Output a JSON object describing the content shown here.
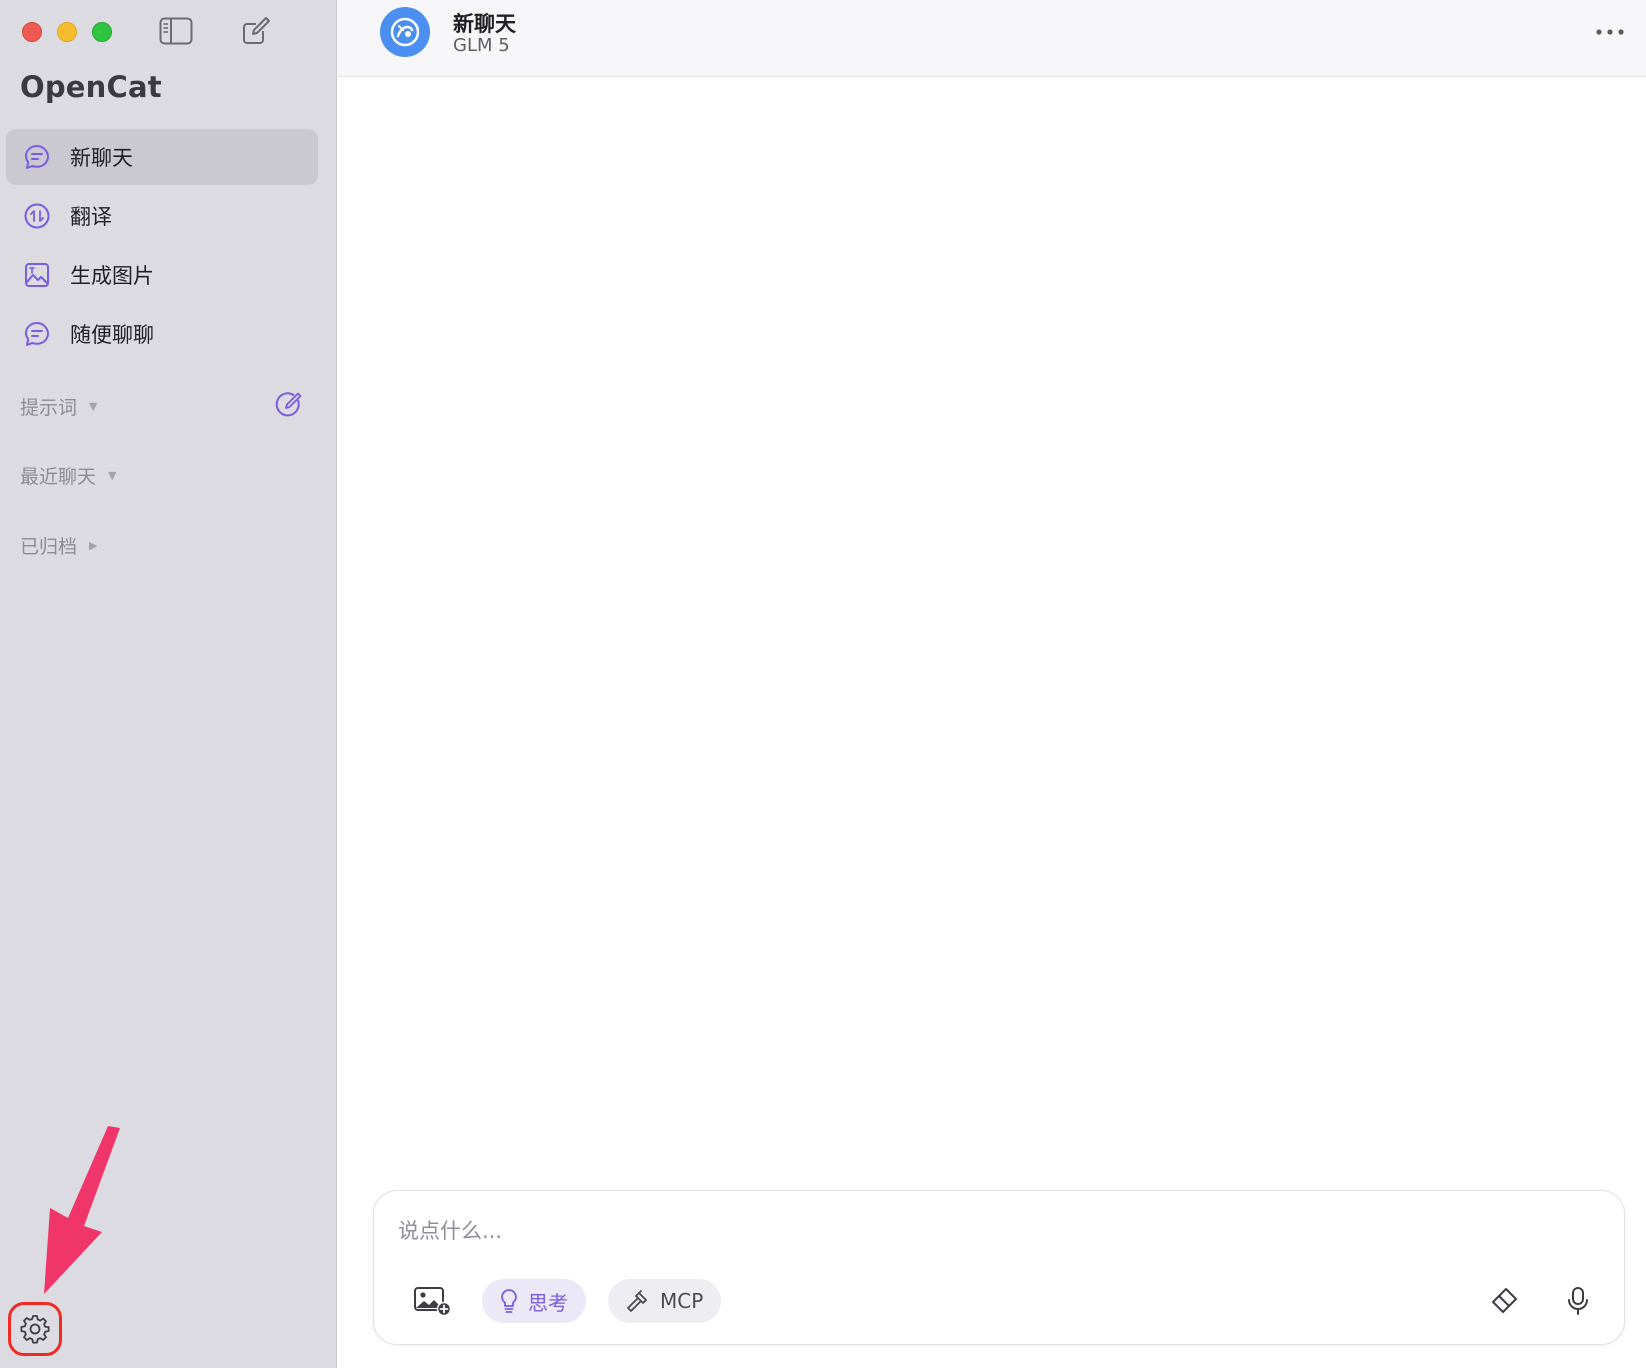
{
  "window": {
    "traffic_lights": [
      "red",
      "yellow",
      "green"
    ]
  },
  "sidebar": {
    "app_title": "OpenCat",
    "items": [
      {
        "label": "新聊天",
        "icon": "chat-bubble-icon",
        "active": true
      },
      {
        "label": "翻译",
        "icon": "translate-icon",
        "active": false
      },
      {
        "label": "生成图片",
        "icon": "image-generate-icon",
        "active": false
      },
      {
        "label": "随便聊聊",
        "icon": "chat-bubble-icon",
        "active": false
      }
    ],
    "sections": {
      "prompts": "提示词",
      "recent": "最近聊天",
      "archived": "已归档"
    }
  },
  "header": {
    "title": "新聊天",
    "model": "GLM 5"
  },
  "composer": {
    "placeholder": "说点什么...",
    "think_label": "思考",
    "mcp_label": "MCP"
  },
  "colors": {
    "accent": "#7a5ce0",
    "sidebar_bg": "#dcdbe2",
    "highlight_red": "#ef2b24",
    "arrow_pink": "#f0356b",
    "avatar_blue": "#4b8ff1"
  }
}
